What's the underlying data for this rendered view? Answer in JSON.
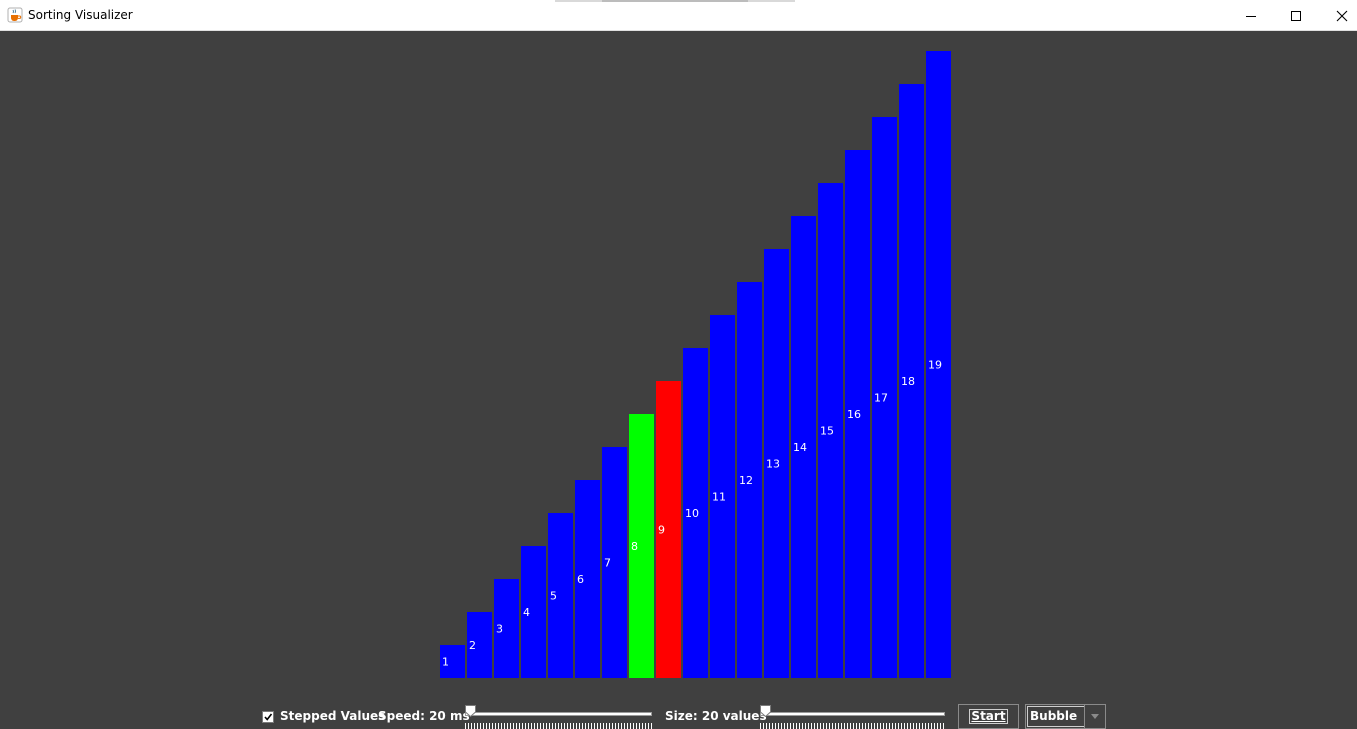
{
  "window": {
    "title": "Sorting Visualizer",
    "app_icon": "java-cup-icon",
    "buttons": [
      "minimize-icon",
      "maximize-icon",
      "close-icon"
    ]
  },
  "bars": {
    "values": [
      1,
      2,
      3,
      4,
      5,
      6,
      7,
      8,
      9,
      10,
      11,
      12,
      13,
      14,
      15,
      16,
      17,
      18,
      19
    ],
    "labels": [
      "1",
      "2",
      "3",
      "4",
      "5",
      "6",
      "7",
      "8",
      "9",
      "10",
      "11",
      "12",
      "13",
      "14",
      "15",
      "16",
      "17",
      "18",
      "19"
    ],
    "default_color": "#0000ff",
    "highlights": {
      "8": "#00ff00",
      "9": "#ff0000"
    },
    "label_color": "#ffffff"
  },
  "controls": {
    "stepped_values": {
      "label": "Stepped Values",
      "checked": true
    },
    "speed": {
      "label": "Speed: 20 ms",
      "value_ms": 20
    },
    "size": {
      "label": "Size: 20 values",
      "value": 20
    },
    "start_button": {
      "label": "Start"
    },
    "algorithm": {
      "selected": "Bubble"
    }
  },
  "colors": {
    "background": "#404040",
    "bar": "#0000ff",
    "compare": "#00ff00",
    "swap": "#ff0000"
  }
}
